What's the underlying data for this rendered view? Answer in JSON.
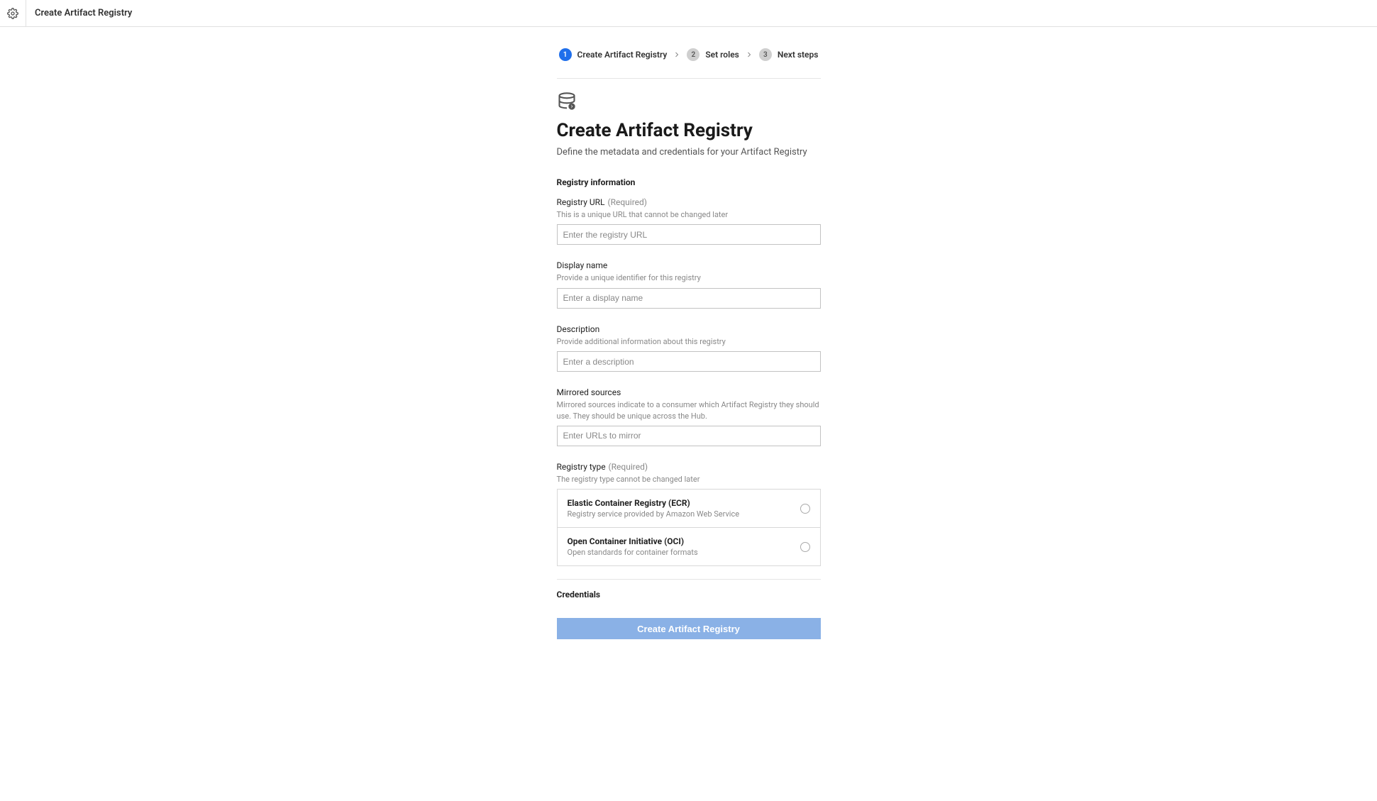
{
  "header": {
    "title": "Create Artifact Registry"
  },
  "stepper": {
    "steps": [
      {
        "num": "1",
        "label": "Create Artifact Registry",
        "active": true
      },
      {
        "num": "2",
        "label": "Set roles",
        "active": false
      },
      {
        "num": "3",
        "label": "Next steps",
        "active": false
      }
    ]
  },
  "page": {
    "title": "Create Artifact Registry",
    "subtitle": "Define the metadata and credentials for your Artifact Registry"
  },
  "sections": {
    "registry_info": {
      "label": "Registry information"
    },
    "credentials": {
      "label": "Credentials"
    }
  },
  "fields": {
    "registry_url": {
      "label": "Registry URL",
      "required": "(Required)",
      "help": "This is a unique URL that cannot be changed later",
      "placeholder": "Enter the registry URL"
    },
    "display_name": {
      "label": "Display name",
      "help": "Provide a unique identifier for this registry",
      "placeholder": "Enter a display name"
    },
    "description": {
      "label": "Description",
      "help": "Provide additional information about this registry",
      "placeholder": "Enter a description"
    },
    "mirrored_sources": {
      "label": "Mirrored sources",
      "help": "Mirrored sources indicate to a consumer which Artifact Registry they should use. They should be unique across the Hub.",
      "placeholder": "Enter URLs to mirror"
    },
    "registry_type": {
      "label": "Registry type",
      "required": "(Required)",
      "help": "The registry type cannot be changed later",
      "options": [
        {
          "title": "Elastic Container Registry (ECR)",
          "desc": "Registry service provided by Amazon Web Service"
        },
        {
          "title": "Open Container Initiative (OCI)",
          "desc": "Open standards for container formats"
        }
      ]
    }
  },
  "submit": {
    "label": "Create Artifact Registry"
  }
}
